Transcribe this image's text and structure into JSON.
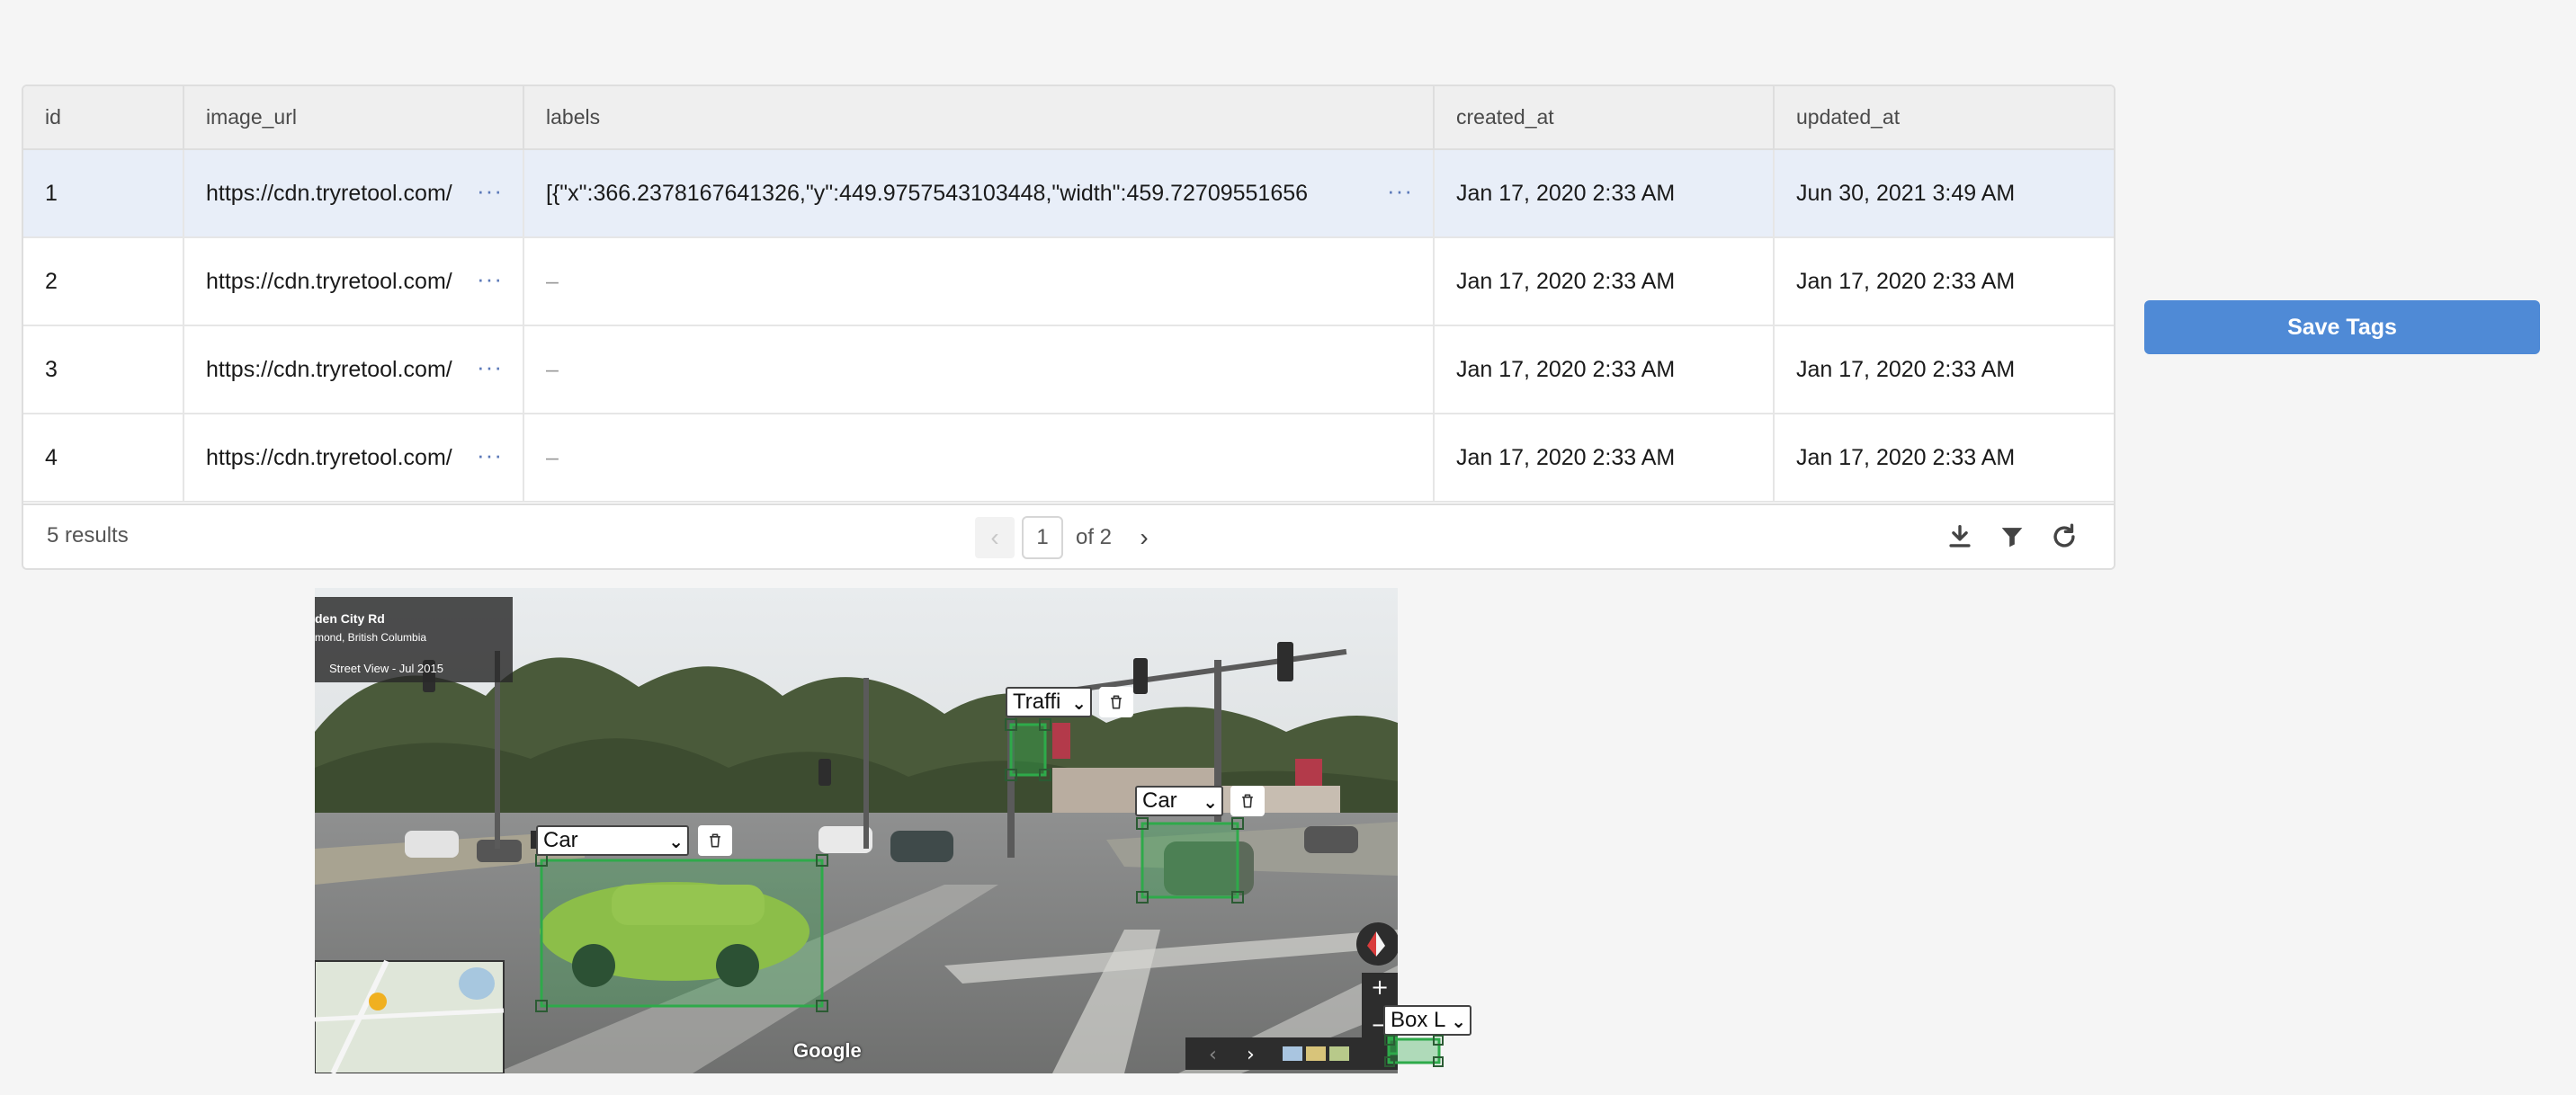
{
  "table": {
    "columns": [
      "id",
      "image_url",
      "labels",
      "created_at",
      "updated_at"
    ],
    "rows": [
      {
        "id": "1",
        "image_url": "https://cdn.tryretool.com/",
        "labels": "[{\"x\":366.2378167641326,\"y\":449.9757543103448,\"width\":459.72709551656",
        "created_at": "Jan 17, 2020 2:33 AM",
        "updated_at": "Jun 30, 2021 3:49 AM"
      },
      {
        "id": "2",
        "image_url": "https://cdn.tryretool.com/",
        "labels": "–",
        "created_at": "Jan 17, 2020 2:33 AM",
        "updated_at": "Jan 17, 2020 2:33 AM"
      },
      {
        "id": "3",
        "image_url": "https://cdn.tryretool.com/",
        "labels": "–",
        "created_at": "Jan 17, 2020 2:33 AM",
        "updated_at": "Jan 17, 2020 2:33 AM"
      },
      {
        "id": "4",
        "image_url": "https://cdn.tryretool.com/",
        "labels": "–",
        "created_at": "Jan 17, 2020 2:33 AM",
        "updated_at": "Jan 17, 2020 2:33 AM"
      }
    ],
    "more_glyph": "···",
    "results_text": "5 results",
    "page_current": "1",
    "page_total_text": "of 2"
  },
  "save_button": {
    "label": "Save Tags"
  },
  "image_annotator": {
    "street_view_card": {
      "line1": "den City Rd",
      "line2": "mond, British Columbia",
      "line3": "Street View - Jul 2015"
    },
    "annotations": [
      {
        "label": "Car"
      },
      {
        "label": "Traffi"
      },
      {
        "label": "Car"
      },
      {
        "label": "Box L"
      }
    ],
    "watermark": "Google"
  },
  "colors": {
    "accent": "#4f8ad6",
    "box_green": "#2eaa4a",
    "row_selected": "#e8eef8"
  }
}
